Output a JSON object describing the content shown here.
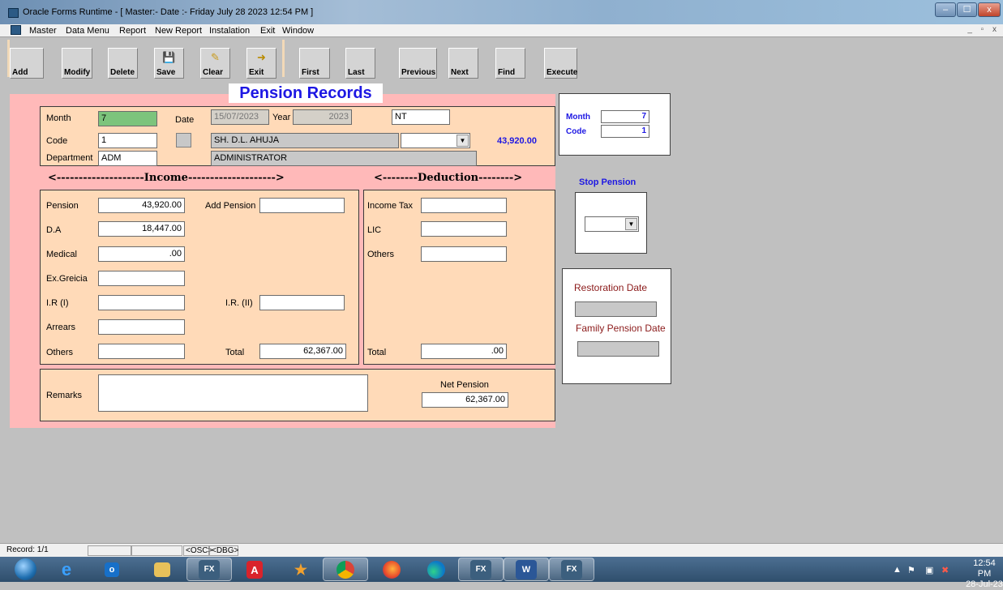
{
  "window": {
    "title": "Oracle Forms Runtime - [ Master:- Date :- Friday July 28 2023 12:54 PM ]",
    "min": "–",
    "max": "☐",
    "close": "x",
    "mdi_controls": "_ ▫ x"
  },
  "menu": [
    "Master",
    "Data Menu",
    "Report",
    "New Report",
    "Instalation",
    "Exit",
    "Window"
  ],
  "toolbar": [
    {
      "label": "Add",
      "icon": ""
    },
    {
      "label": "Modify",
      "icon": ""
    },
    {
      "label": "Delete",
      "icon": ""
    },
    {
      "label": "Save",
      "icon": "floppy-icon"
    },
    {
      "label": "Clear",
      "icon": "eraser-icon"
    },
    {
      "label": "Exit",
      "icon": "exit-door-icon"
    },
    {
      "label": "First",
      "icon": ""
    },
    {
      "label": "Last",
      "icon": ""
    },
    {
      "label": "Previous",
      "icon": ""
    },
    {
      "label": "Next",
      "icon": ""
    },
    {
      "label": "Find",
      "icon": ""
    },
    {
      "label": "Execute",
      "icon": ""
    }
  ],
  "form": {
    "title": "Pension Records",
    "header": {
      "month_label": "Month",
      "month_value": "7",
      "date_label": "Date",
      "date_value": "15/07/2023",
      "year_label": "Year",
      "year_value": "2023",
      "nt_value": "NT",
      "code_label": "Code",
      "code_value": "1",
      "name_value": "SH. D.L. AHUJA",
      "amount": "43,920.00",
      "dept_label": "Department",
      "dept_value": "ADM",
      "dept_name": "ADMINISTRATOR"
    },
    "income_heading": "<--------------------Income-------------------->",
    "deduction_heading": "<--------Deduction-------->",
    "income": {
      "pension_label": "Pension",
      "pension_value": "43,920.00",
      "add_pension_label": "Add Pension",
      "add_pension_value": "",
      "da_label": "D.A",
      "da_value": "18,447.00",
      "medical_label": "Medical",
      "medical_value": ".00",
      "exgreicia_label": "Ex.Greicia",
      "exgreicia_value": "",
      "ir1_label": "I.R (I)",
      "ir1_value": "",
      "ir2_label": "I.R. (II)",
      "ir2_value": "",
      "arrears_label": "Arrears",
      "arrears_value": "",
      "others_label": "Others",
      "others_value": "",
      "total_label": "Total",
      "total_value": "62,367.00"
    },
    "deduction": {
      "income_tax_label": "Income Tax",
      "income_tax_value": "",
      "lic_label": "LIC",
      "lic_value": "",
      "others_label": "Others",
      "others_value": "",
      "total_label": "Total",
      "total_value": ".00"
    },
    "remarks_label": "Remarks",
    "remarks_value": "",
    "net_pension_label": "Net Pension",
    "net_pension_value": "62,367.00"
  },
  "side": {
    "month_label": "Month",
    "month_value": "7",
    "code_label": "Code",
    "code_value": "1",
    "stop_pension_label": "Stop Pension",
    "stop_pension_value": "",
    "restoration_label": "Restoration Date",
    "restoration_value": "",
    "family_pension_label": "Family Pension Date",
    "family_pension_value": ""
  },
  "status": {
    "record": "Record: 1/1",
    "osc": "<OSC>",
    "dbg": "<DBG>"
  },
  "taskbar": {
    "items": [
      "windows-start-icon",
      "internet-explorer-icon",
      "outlook-icon",
      "file-explorer-icon",
      "oracle-forms-icon",
      "acrobat-icon",
      "app-icon",
      "chrome-icon",
      "firefox-icon",
      "edge-icon",
      "oracle-forms-icon",
      "word-icon",
      "oracle-forms-icon"
    ],
    "time": "12:54 PM",
    "date": "28-Jul-23"
  },
  "colors": {
    "form_bg": "#ffb9b9",
    "pane_bg": "#ffdab8",
    "title_blue": "#1d17e3",
    "month_green": "#7cc47c",
    "restoration_red": "#8b1a1a"
  }
}
